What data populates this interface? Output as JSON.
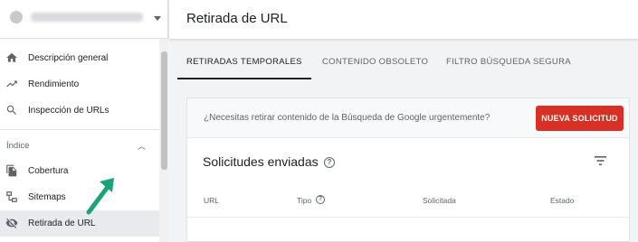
{
  "sidebar": {
    "property_icon": "globe-icon",
    "items": [
      {
        "label": "Descripción general",
        "icon": "home-icon"
      },
      {
        "label": "Rendimiento",
        "icon": "trending-up-icon"
      },
      {
        "label": "Inspección de URLs",
        "icon": "search-icon"
      }
    ],
    "section": {
      "title": "Índice",
      "items": [
        {
          "label": "Cobertura",
          "icon": "file-copy-icon"
        },
        {
          "label": "Sitemaps",
          "icon": "sitemap-icon"
        },
        {
          "label": "Retirada de URL",
          "icon": "eye-off-icon",
          "active": true
        }
      ]
    }
  },
  "header": {
    "title": "Retirada de URL"
  },
  "tabs": [
    {
      "label": "RETIRADAS TEMPORALES",
      "active": true
    },
    {
      "label": "CONTENIDO OBSOLETO"
    },
    {
      "label": "FILTRO BÚSQUEDA SEGURA"
    }
  ],
  "banner": {
    "text": "¿Necesitas retirar contenido de la Búsqueda de Google urgentemente?",
    "button": "NUEVA SOLICITUD"
  },
  "requests": {
    "title": "Solicitudes enviadas",
    "columns": [
      "URL",
      "Tipo",
      "Solicitada",
      "Estado"
    ]
  },
  "colors": {
    "accent_red": "#d93025",
    "annotation_arrow": "#1aa37a"
  }
}
